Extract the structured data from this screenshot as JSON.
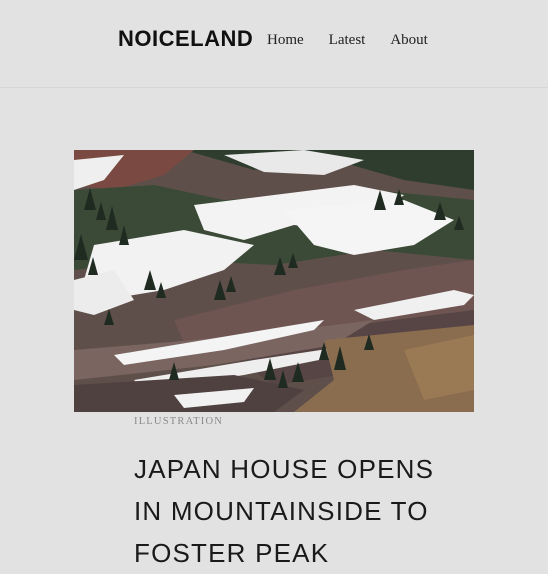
{
  "header": {
    "brand": "NOICELAND",
    "nav": [
      {
        "label": "Home"
      },
      {
        "label": "Latest"
      },
      {
        "label": "About"
      }
    ]
  },
  "article": {
    "category": "ILLUSTRATION",
    "title": "JAPAN HOUSE OPENS IN MOUNTAINSIDE TO FOSTER PEAK"
  }
}
